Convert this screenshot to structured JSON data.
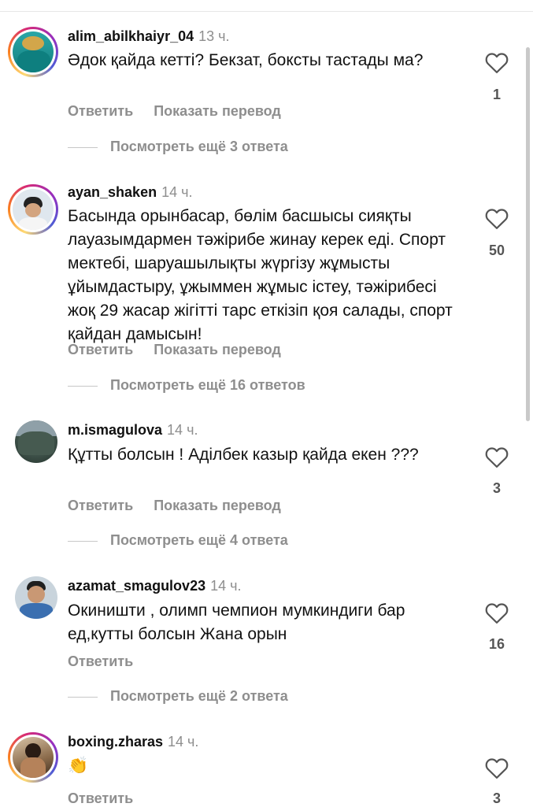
{
  "comments": [
    {
      "username": "alim_abilkhaiyr_04",
      "time": "13 ч.",
      "text": "Әдок қайда кетті? Бекзат, боксты тастады ма?",
      "reply": "Ответить",
      "translate": "Показать перевод",
      "likes": "1",
      "view_replies": "Посмотреть ещё 3 ответа"
    },
    {
      "username": "ayan_shaken",
      "time": "14 ч.",
      "text": "Басында орынбасар, бөлім басшысы сияқты лауазымдармен тәжірибе жинау керек еді. Спорт мектебі, шаруашылықты жүргізу жұмысты ұйымдастыру, ұжыммен жұмыс істеу, тәжірибесі жоқ 29 жасар жігітті тарс еткізіп қоя салады, спорт қайдан дамысын!",
      "reply": "Ответить",
      "translate": "Показать перевод",
      "likes": "50",
      "view_replies": "Посмотреть ещё 16 ответов"
    },
    {
      "username": "m.ismagulova",
      "time": "14 ч.",
      "text": "Құтты болсын ! Аділбек казыр қайда екен ???",
      "reply": "Ответить",
      "translate": "Показать перевод",
      "likes": "3",
      "view_replies": "Посмотреть ещё 4 ответа"
    },
    {
      "username": "azamat_smagulov23",
      "time": "14 ч.",
      "text": "Окиништи , олимп чемпион  мумкиндиги бар ед,кутты болсын Жана орын",
      "reply": "Ответить",
      "likes": "16",
      "view_replies": "Посмотреть ещё 2 ответа"
    },
    {
      "username": "boxing.zharas",
      "time": "14 ч.",
      "text": "👏",
      "reply": "Ответить",
      "likes": "3"
    }
  ],
  "icons": {
    "like": "heart-outline-icon"
  },
  "colors": {
    "secondary_text": "#8e8e8e",
    "primary_text": "#111111",
    "story_ring": "#d62976"
  }
}
